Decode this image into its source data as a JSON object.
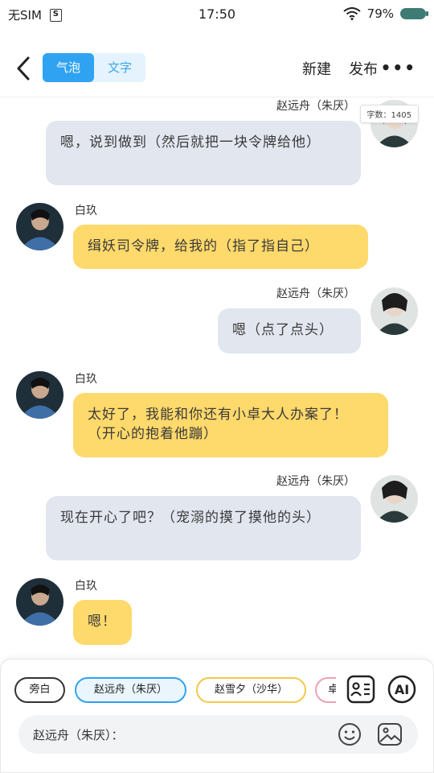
{
  "status_bar": {
    "carrier": "无SIM",
    "time": "17:50",
    "battery": "79%"
  },
  "header": {
    "tabs": [
      {
        "label": "气泡",
        "active": true
      },
      {
        "label": "文字",
        "active": false
      }
    ],
    "new_label": "新建",
    "publish_label": "发布",
    "more_label": "•••"
  },
  "word_count": "字数：1405",
  "messages": [
    {
      "side": "right",
      "speaker": "赵远舟（朱厌）",
      "text": "嗯，说到做到（然后就把一块令牌给他）"
    },
    {
      "side": "left",
      "speaker": "白玖",
      "text": "缉妖司令牌，给我的（指了指自己）"
    },
    {
      "side": "right",
      "speaker": "赵远舟（朱厌）",
      "text": "嗯（点了点头）"
    },
    {
      "side": "left",
      "speaker": "白玖",
      "text": "太好了，我能和你还有小卓大人办案了！（开心的抱着他蹦）"
    },
    {
      "side": "right",
      "speaker": "赵远舟（朱厌）",
      "text": "现在开心了吧？（宠溺的摸了摸他的头）"
    },
    {
      "side": "left",
      "speaker": "白玖",
      "text": "嗯！"
    }
  ],
  "role_chips": [
    {
      "label": "旁白",
      "border": "#333333"
    },
    {
      "label": "赵远舟（朱厌）",
      "border": "#2fa3f2",
      "selected": true
    },
    {
      "label": "赵雪夕（沙华）",
      "border": "#f2c94c"
    },
    {
      "label": "卓",
      "border": "#f2a0b4"
    }
  ],
  "input": {
    "label": "赵远舟（朱厌）：",
    "placeholder": ""
  },
  "colors": {
    "accent": "#2fa3f2",
    "bubble_right": "#e1e6ef",
    "bubble_left": "#fed96b"
  },
  "icons": {
    "back": "chevron-left-icon",
    "roles": "contact-card-icon",
    "ai": "ai-icon",
    "emoji": "smiley-icon",
    "image": "image-icon"
  }
}
